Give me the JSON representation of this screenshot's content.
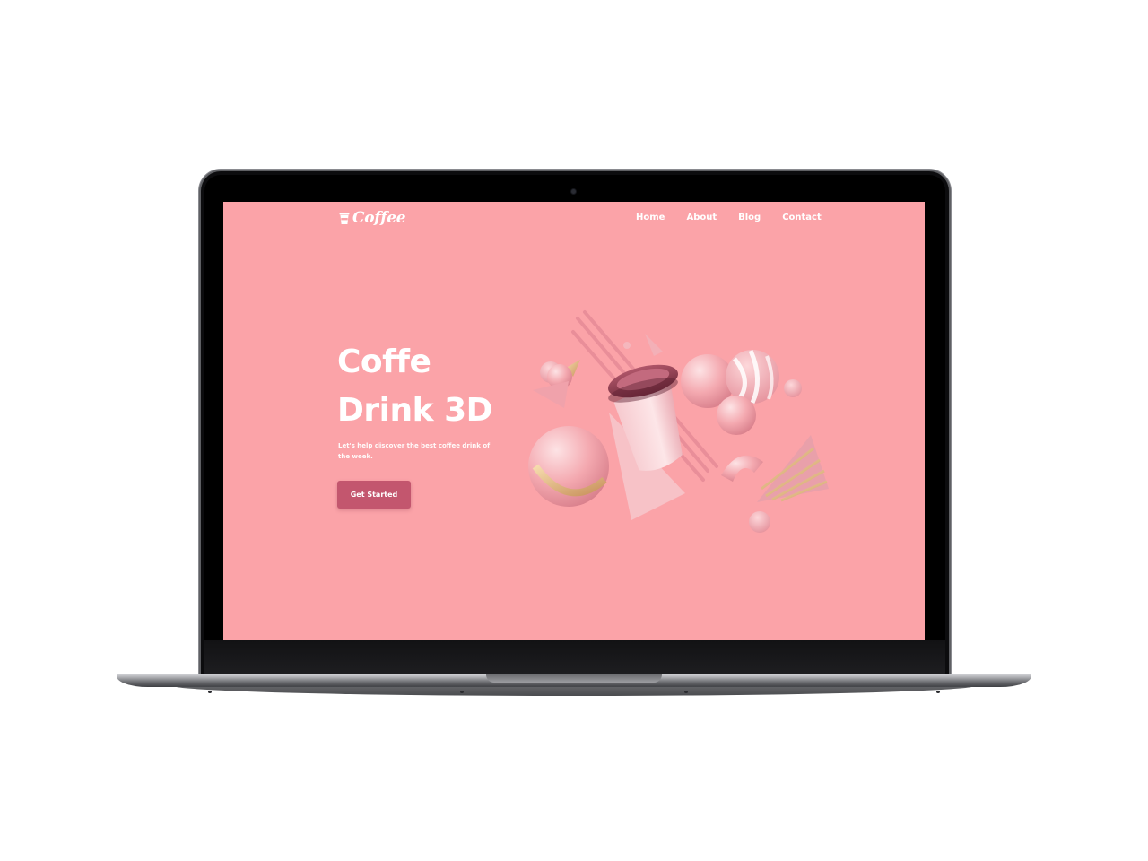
{
  "site": {
    "brand": "Coffee",
    "nav": [
      "Home",
      "About",
      "Blog",
      "Contact"
    ],
    "hero": {
      "title_line1": "Coffe",
      "title_line2": "Drink 3D",
      "subtitle": "Let's help discover the best coffee drink of the week.",
      "cta_label": "Get Started"
    }
  },
  "colors": {
    "background": "#fba3a8",
    "accent": "#c3566e",
    "text": "#ffffff"
  },
  "icons": {
    "brand_icon": "coffee-cup-icon"
  }
}
